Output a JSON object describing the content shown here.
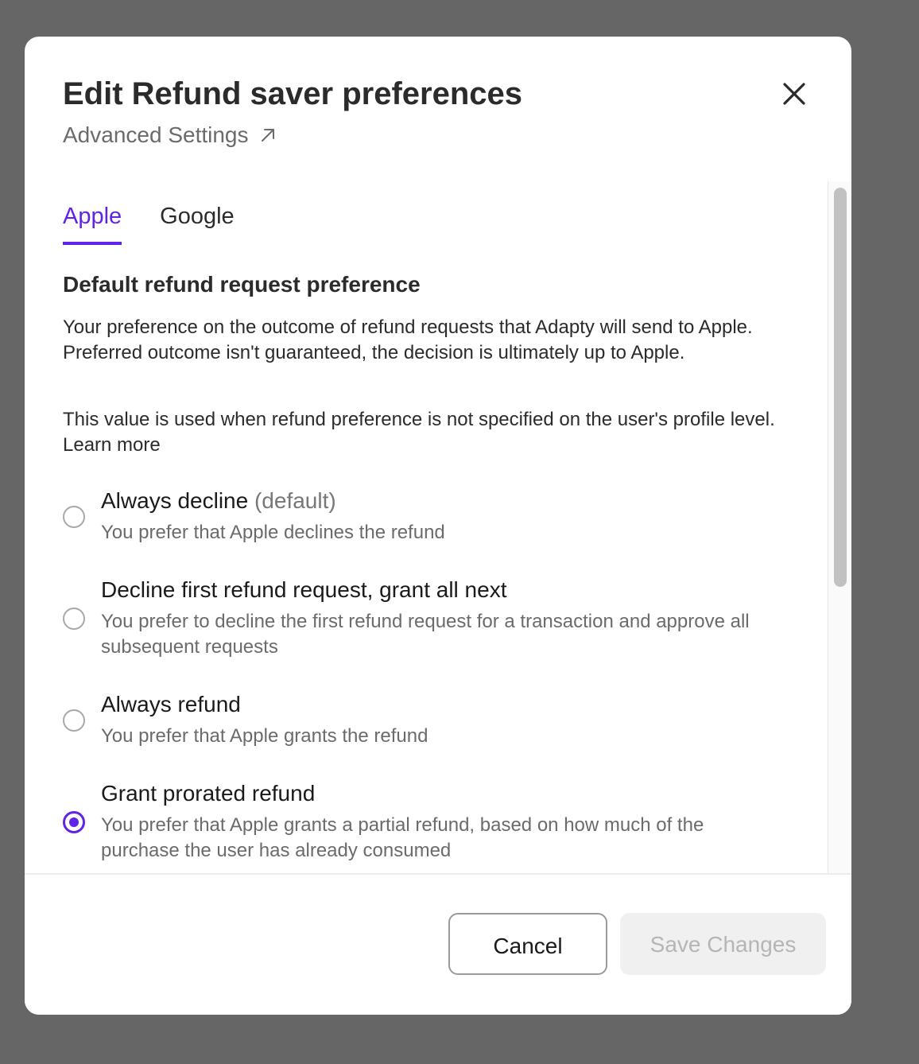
{
  "modal": {
    "title": "Edit Refund saver preferences",
    "advanced_link_label": "Advanced Settings"
  },
  "tabs": [
    {
      "label": "Apple",
      "active": true
    },
    {
      "label": "Google",
      "active": false
    }
  ],
  "section": {
    "heading": "Default refund request preference",
    "paragraph1": "Your preference on the outcome of refund requests that Adapty will send to Apple. Preferred outcome isn't guaranteed, the decision is ultimately up to Apple.",
    "paragraph2": "This value is used when refund preference is not specified on the user's profile level. Learn more"
  },
  "options": [
    {
      "title": "Always decline",
      "suffix": "(default)",
      "description": "You prefer that Apple declines the refund",
      "selected": false
    },
    {
      "title": "Decline first refund request, grant all next",
      "suffix": "",
      "description": "You prefer to decline the first refund request for a transaction and approve all subsequent requests",
      "selected": false
    },
    {
      "title": "Always refund",
      "suffix": "",
      "description": "You prefer that Apple grants the refund",
      "selected": false
    },
    {
      "title": "Grant prorated refund",
      "suffix": "",
      "description": "You prefer that Apple grants a partial refund, based on how much of the purchase the user has already consumed",
      "selected": true
    }
  ],
  "footer": {
    "cancel_label": "Cancel",
    "save_label": "Save Changes"
  },
  "colors": {
    "accent": "#6223e8",
    "overlay": "#666666"
  },
  "icons": {
    "close": "close-icon",
    "external_link": "arrow-up-right-icon"
  }
}
